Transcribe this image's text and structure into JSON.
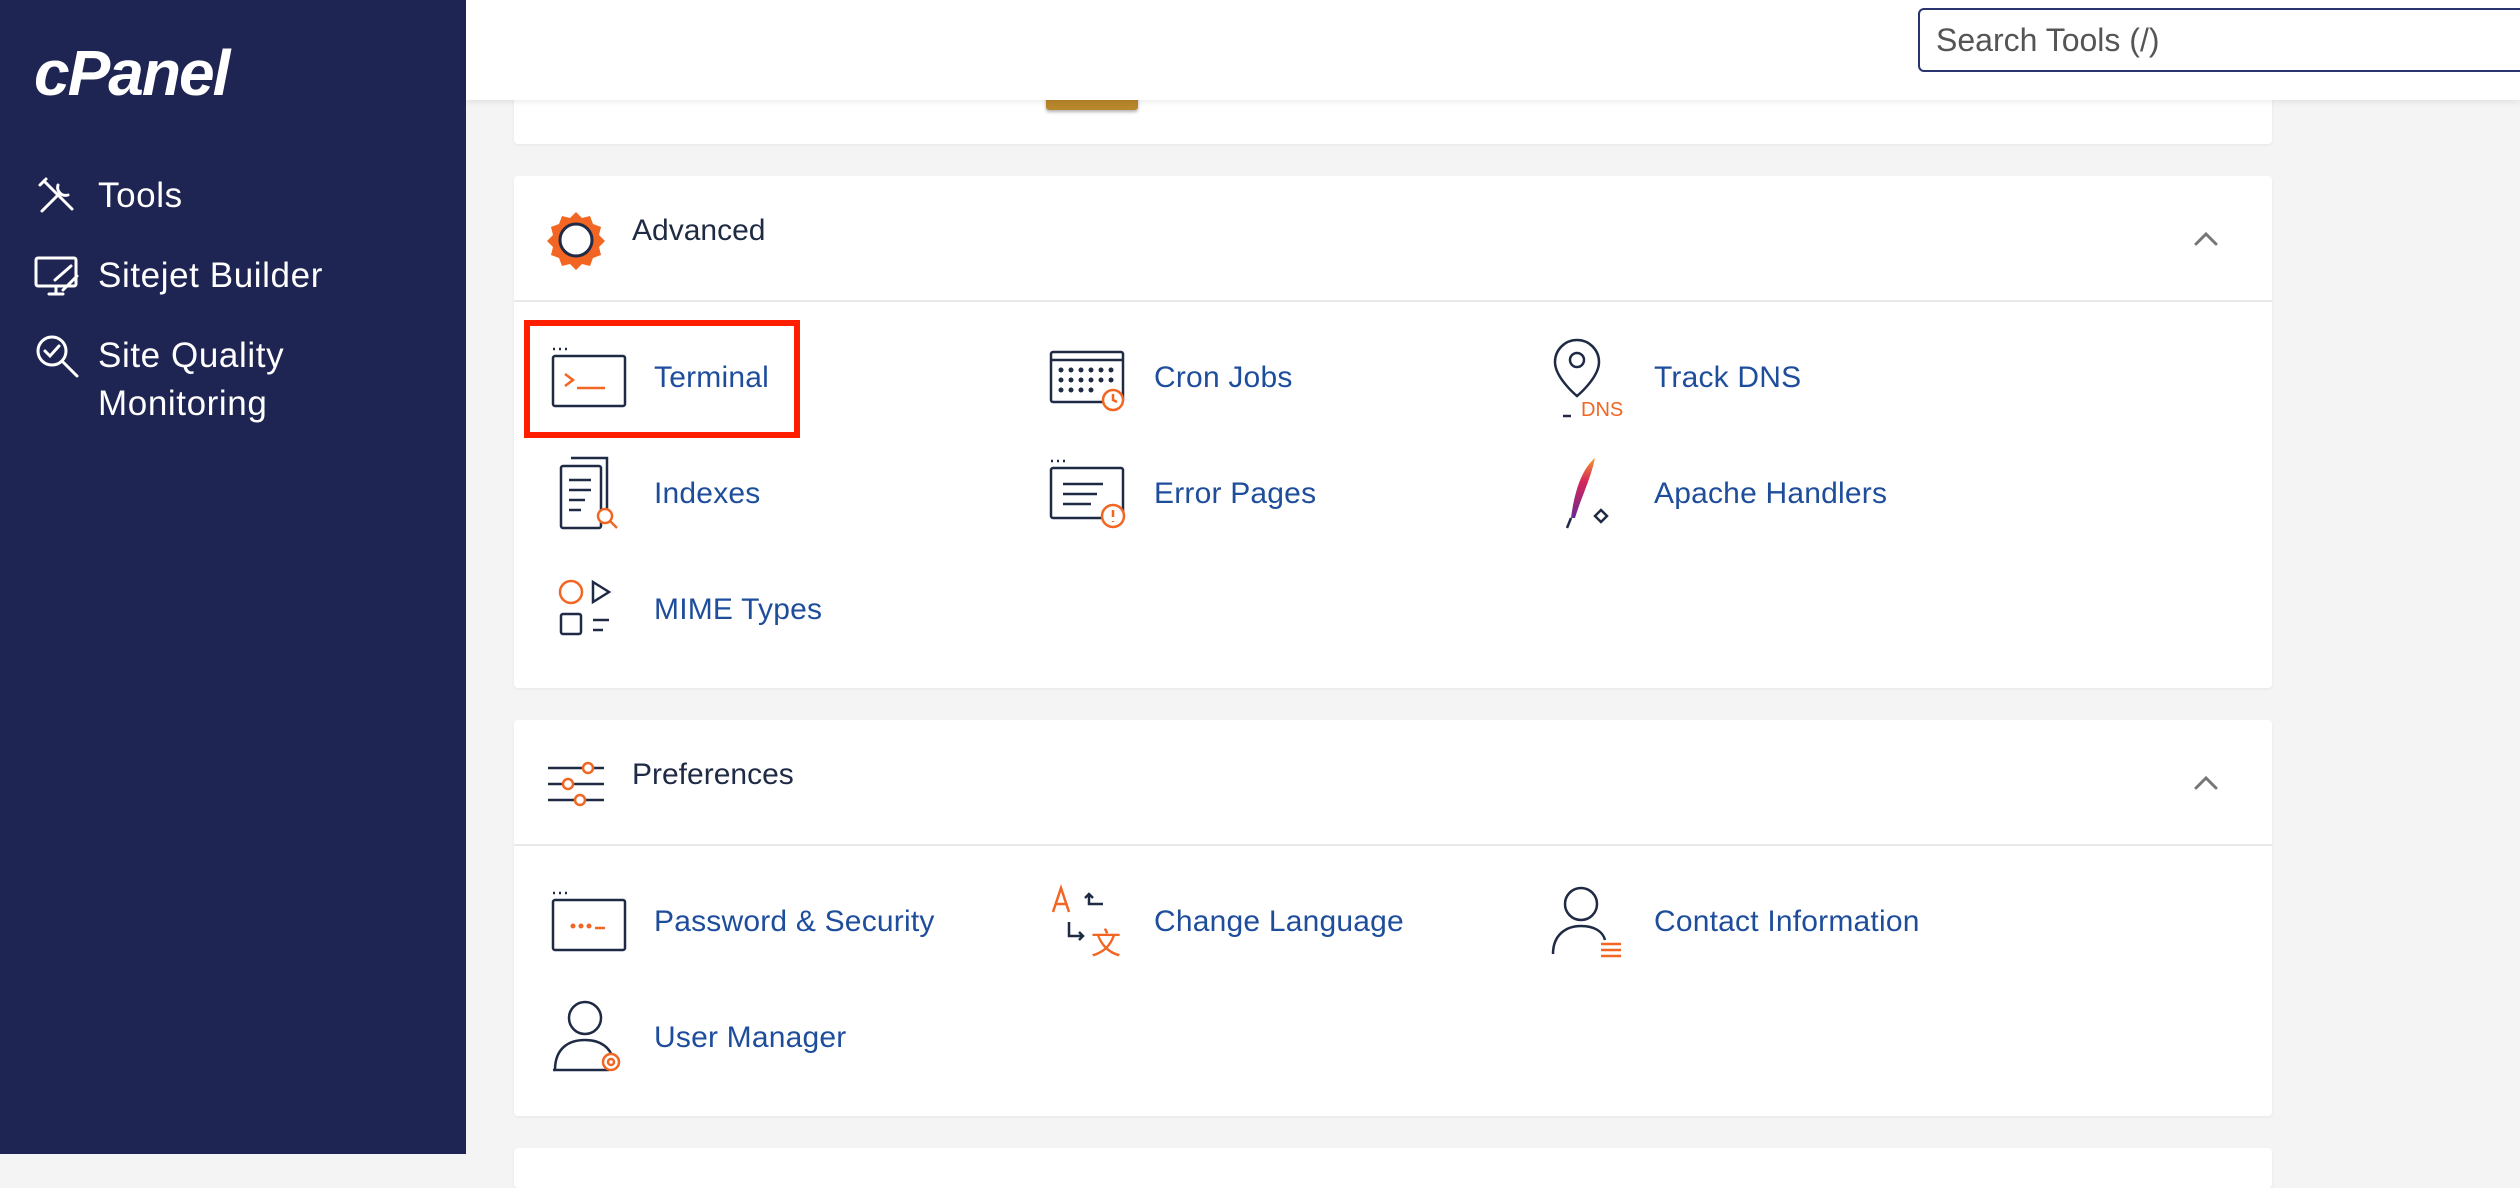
{
  "app": {
    "logo": "cPanel"
  },
  "search": {
    "placeholder": "Search Tools (/)"
  },
  "sidebar": {
    "items": [
      {
        "label": "Tools",
        "icon": "tools-icon"
      },
      {
        "label": "Sitejet Builder",
        "icon": "monitor-pen-icon"
      },
      {
        "label": "Site Quality Monitoring",
        "icon": "magnifier-check-icon"
      }
    ]
  },
  "sections": [
    {
      "title": "Advanced",
      "icon": "gear-icon",
      "tools": [
        {
          "label": "Terminal",
          "icon": "terminal-icon"
        },
        {
          "label": "Cron Jobs",
          "icon": "calendar-clock-icon"
        },
        {
          "label": "Track DNS",
          "icon": "map-pin-dns-icon"
        },
        {
          "label": "Indexes",
          "icon": "document-search-icon"
        },
        {
          "label": "Error Pages",
          "icon": "window-warning-icon"
        },
        {
          "label": "Apache Handlers",
          "icon": "feather-icon"
        },
        {
          "label": "MIME Types",
          "icon": "shapes-icon"
        }
      ]
    },
    {
      "title": "Preferences",
      "icon": "sliders-icon",
      "tools": [
        {
          "label": "Password & Security",
          "icon": "password-window-icon"
        },
        {
          "label": "Change Language",
          "icon": "translate-icon"
        },
        {
          "label": "Contact Information",
          "icon": "user-list-icon"
        },
        {
          "label": "User Manager",
          "icon": "user-gear-icon"
        }
      ]
    }
  ],
  "dns_badge": "DNS",
  "colors": {
    "sidebar": "#1f2553",
    "accent": "#f26522",
    "link": "#1e4d9b",
    "highlight": "#ff1f00"
  }
}
